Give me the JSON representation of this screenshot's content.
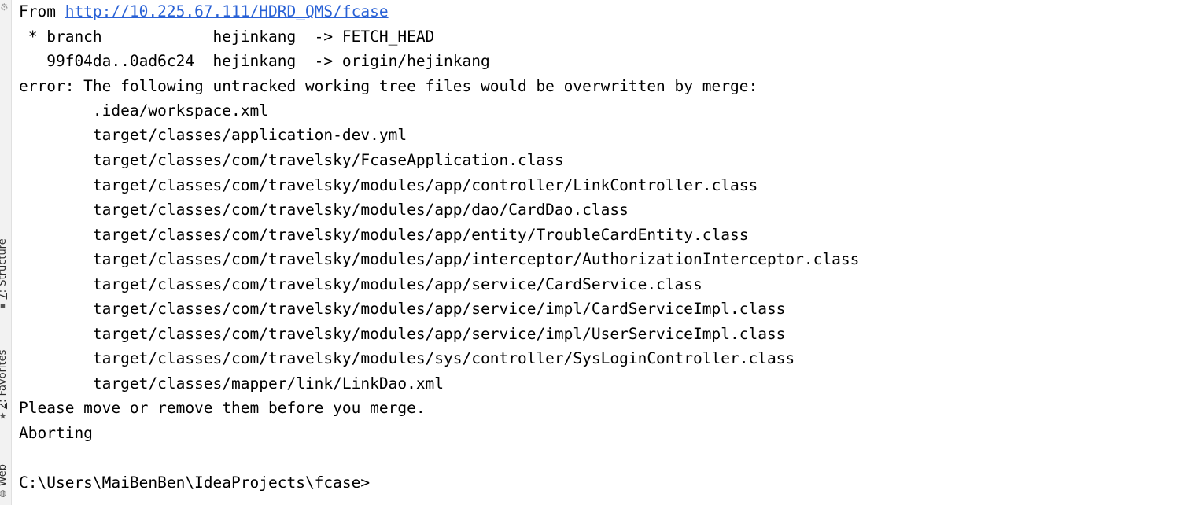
{
  "side_tabs": {
    "structure": {
      "mnemonic": "7",
      "label": ": Structure"
    },
    "favorites": {
      "mnemonic": "2",
      "label": ": Favorites"
    },
    "web": {
      "label": "Web"
    }
  },
  "terminal": {
    "from_prefix": "From ",
    "from_url": "http://10.225.67.111/HDRD_QMS/fcase",
    "lines": [
      " * branch            hejinkang  -> FETCH_HEAD",
      "   99f04da..0ad6c24  hejinkang  -> origin/hejinkang",
      "error: The following untracked working tree files would be overwritten by merge:",
      "        .idea/workspace.xml",
      "        target/classes/application-dev.yml",
      "        target/classes/com/travelsky/FcaseApplication.class",
      "        target/classes/com/travelsky/modules/app/controller/LinkController.class",
      "        target/classes/com/travelsky/modules/app/dao/CardDao.class",
      "        target/classes/com/travelsky/modules/app/entity/TroubleCardEntity.class",
      "        target/classes/com/travelsky/modules/app/interceptor/AuthorizationInterceptor.class",
      "        target/classes/com/travelsky/modules/app/service/CardService.class",
      "        target/classes/com/travelsky/modules/app/service/impl/CardServiceImpl.class",
      "        target/classes/com/travelsky/modules/app/service/impl/UserServiceImpl.class",
      "        target/classes/com/travelsky/modules/sys/controller/SysLoginController.class",
      "        target/classes/mapper/link/LinkDao.xml",
      "Please move or remove them before you merge.",
      "Aborting",
      "",
      "C:\\Users\\MaiBenBen\\IdeaProjects\\fcase>"
    ]
  },
  "icons": {
    "top_left": "settings-icon",
    "structure": "structure-icon",
    "favorites": "star-icon",
    "web": "globe-icon"
  }
}
